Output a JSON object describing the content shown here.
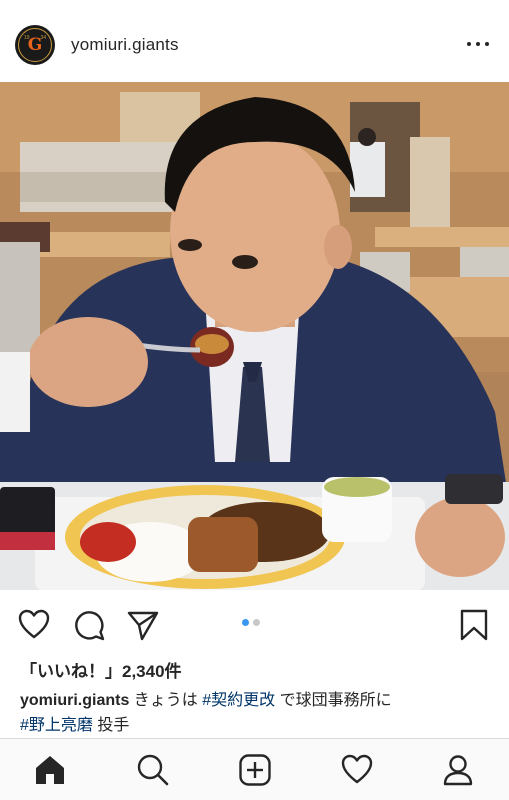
{
  "post": {
    "username": "yomiuri.giants",
    "avatar_logo": {
      "letter": "G",
      "year_left": "19",
      "year_right": "34"
    },
    "image_count": 2,
    "active_image": 1
  },
  "likes_text": "「いいね！」2,340件",
  "caption": {
    "username": "yomiuri.giants",
    "text_1": " きょうは ",
    "hashtag_1": "#契約更改",
    "text_2": " で球団事務所に",
    "hashtag_2": "#野上亮磨",
    "text_3": " 投手"
  },
  "icons": {
    "header": [
      "more-options-icon"
    ],
    "actions": [
      "heart-icon",
      "comment-icon",
      "share-icon",
      "bookmark-icon"
    ],
    "tabbar": [
      "home-icon",
      "search-icon",
      "new-post-icon",
      "activity-heart-icon",
      "profile-icon"
    ]
  },
  "colors": {
    "hashtag": "#003569",
    "active_dot": "#3897f0",
    "inactive_dot": "#c7c7c7"
  }
}
